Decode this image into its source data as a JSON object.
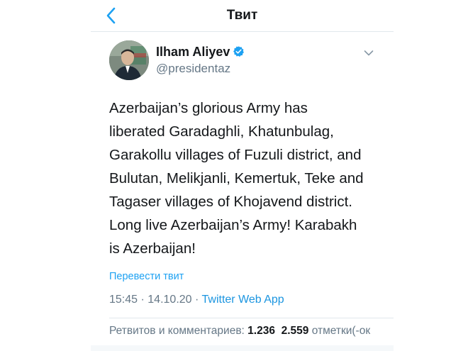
{
  "nav": {
    "title": "Твит",
    "back_icon": "chevron-left-icon"
  },
  "tweet": {
    "author_name": "Ilham Aliyev",
    "author_handle": "@presidentaz",
    "verified_icon": "verified-badge-icon",
    "menu_icon": "chevron-down-icon",
    "text_lines": [
      "Azerbaijan’s glorious Army has",
      "liberated Garadaghli, Khatunbulag,",
      "Garakollu villages of Fuzuli district, and",
      "Bulutan, Melikjanli, Kemertuk, Teke and",
      "Tagaser villages of Khojavend district.",
      "Long live Azerbaijan’s Army! Karabakh",
      "is Azerbaijan!"
    ],
    "translate_label": "Перевести твит",
    "time": "15:45",
    "separator": "·",
    "date": "14.10.20",
    "source": "Twitter Web App",
    "stats": {
      "retweets_label": "Ретвитов и комментариев:",
      "retweets_count": "1.236",
      "likes_count": "2.559",
      "likes_label": "отметки(-ок"
    }
  },
  "colors": {
    "accent": "#1da1f2",
    "text_primary": "#14171a",
    "text_secondary": "#657786",
    "divider": "#e1e8ed"
  }
}
